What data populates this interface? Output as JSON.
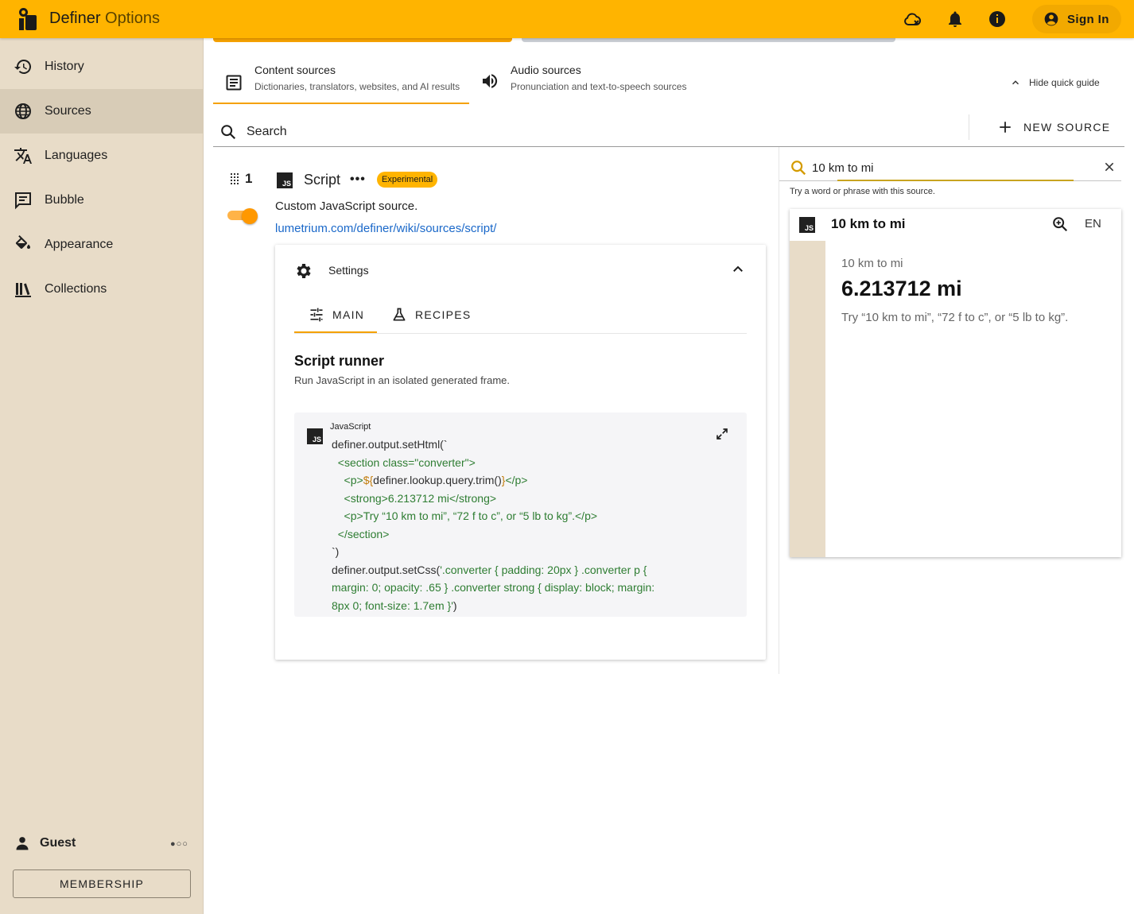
{
  "app": {
    "title_main": "Definer",
    "title_sub": "Options",
    "sign_in": "Sign In"
  },
  "sidebar": {
    "items": [
      {
        "label": "History",
        "icon": "history-icon"
      },
      {
        "label": "Sources",
        "icon": "globe-icon",
        "active": true
      },
      {
        "label": "Languages",
        "icon": "translate-icon"
      },
      {
        "label": "Bubble",
        "icon": "chat-bubble-icon"
      },
      {
        "label": "Appearance",
        "icon": "paint-bucket-icon"
      },
      {
        "label": "Collections",
        "icon": "library-icon"
      }
    ],
    "guest": "Guest",
    "dots": "●○○",
    "membership": "MEMBERSHIP"
  },
  "tabs": {
    "content": {
      "title": "Content sources",
      "desc": "Dictionaries, translators, websites, and AI results"
    },
    "audio": {
      "title": "Audio sources",
      "desc": "Pronunciation and text-to-speech sources"
    },
    "hide_guide": "Hide quick guide"
  },
  "search": {
    "label": "Search",
    "new_source": "NEW SOURCE"
  },
  "source": {
    "index": "1",
    "name": "Script",
    "more": "•••",
    "badge": "Experimental",
    "badge_color": "#ffb400",
    "description": "Custom JavaScript source.",
    "link": "lumetrium.com/definer/wiki/sources/script/",
    "js_badge": "JS",
    "enabled": true
  },
  "settings": {
    "title": "Settings",
    "tab_main": "MAIN",
    "tab_recipes": "RECIPES",
    "runner_title": "Script runner",
    "runner_desc": "Run JavaScript in an isolated generated frame.",
    "code_lang": "JavaScript",
    "code": {
      "l1": "definer.output.setHtml(`",
      "l2": "  <section class=\"converter\">",
      "l3a": "    <p>",
      "l3b": "${",
      "l3c": "definer.lookup.query.trim()",
      "l3d": "}",
      "l3e": "</p>",
      "l4": "    <strong>6.213712 mi</strong>",
      "l5": "    <p>Try “10 km to mi”, “72 f to c”, or “5 lb to kg”.</p>",
      "l6": "  </section>",
      "l7": "`)",
      "l8a": "definer.output.setCss(",
      "l8b": "'.converter { padding: 20px } .converter p {",
      "l9": "margin: 0; opacity: .65 } .converter strong { display: block; margin:",
      "l10a": "8px 0; font-size: 1.7em }'",
      "l10b": ")"
    }
  },
  "preview": {
    "query": "10 km to mi",
    "hint": "Try a word or phrase with this source.",
    "card_title": "10 km to mi",
    "lang": "EN",
    "result_query": "10 km to mi",
    "result_value": "6.213712 mi",
    "result_tip": "Try “10 km to mi”, “72 f to c”, or “5 lb to kg”."
  },
  "colors": {
    "accent": "#ffb400",
    "sidebar_bg": "#e8dcc8",
    "link": "#1a68c9",
    "code_string": "#2e7d32"
  }
}
